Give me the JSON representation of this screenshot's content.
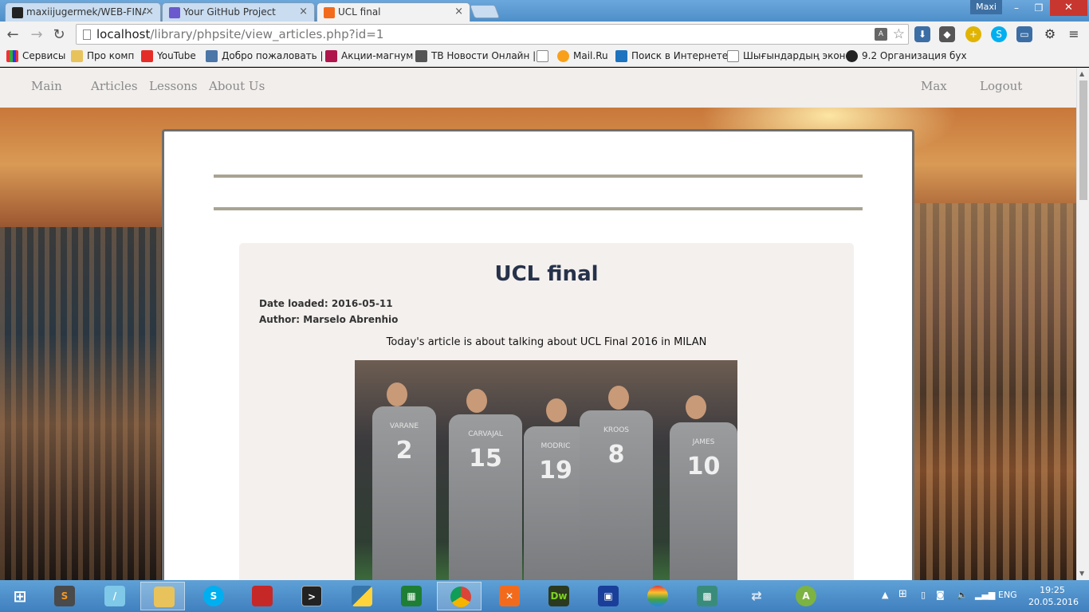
{
  "browser": {
    "tabs": [
      {
        "label": "maxiijugermek/WEB-FINA",
        "active": false
      },
      {
        "label": "Your GitHub Project",
        "active": false
      },
      {
        "label": "UCL final",
        "active": true
      }
    ],
    "window_user": "Maxi",
    "url_host": "localhost",
    "url_path": "/library/phpsite/view_articles.php?id=1",
    "bookmarks": [
      "Сервисы",
      "Про комп",
      "YouTube",
      "Добро пожаловать |",
      "Акции-магнум",
      "ТВ Новости Онлайн |",
      "",
      "Mail.Ru",
      "Поиск в Интернете",
      "Шығындардың эконо",
      "9.2 Организация бух"
    ]
  },
  "site": {
    "nav": {
      "main": "Main",
      "articles": "Articles",
      "lessons": "Lessons",
      "about": "About Us",
      "user": "Max",
      "logout": "Logout"
    },
    "article": {
      "title": "UCL final",
      "date_line": "Date loaded: 2016-05-11",
      "author_line": "Author: Marselo Abrenhio",
      "lead": "Today's article is about talking about UCL Final 2016 in MILAN",
      "photo_jerseys": [
        {
          "name": "VARANE",
          "number": "2"
        },
        {
          "name": "CARVAJAL",
          "number": "15"
        },
        {
          "name": "MODRIC",
          "number": "19"
        },
        {
          "name": "KROOS",
          "number": "8"
        },
        {
          "name": "JAMES",
          "number": "10"
        }
      ]
    }
  },
  "taskbar": {
    "apps": [
      "start",
      "sublime-text",
      "notepad",
      "file-explorer",
      "skype",
      "book",
      "terminal",
      "python",
      "calculator",
      "chrome",
      "xampp",
      "dreamweaver",
      "save-disk",
      "colorful-ball",
      "network-tool",
      "arrows",
      "android-studio"
    ],
    "language": "ENG",
    "time": "19:25",
    "date": "20.05.2016"
  }
}
